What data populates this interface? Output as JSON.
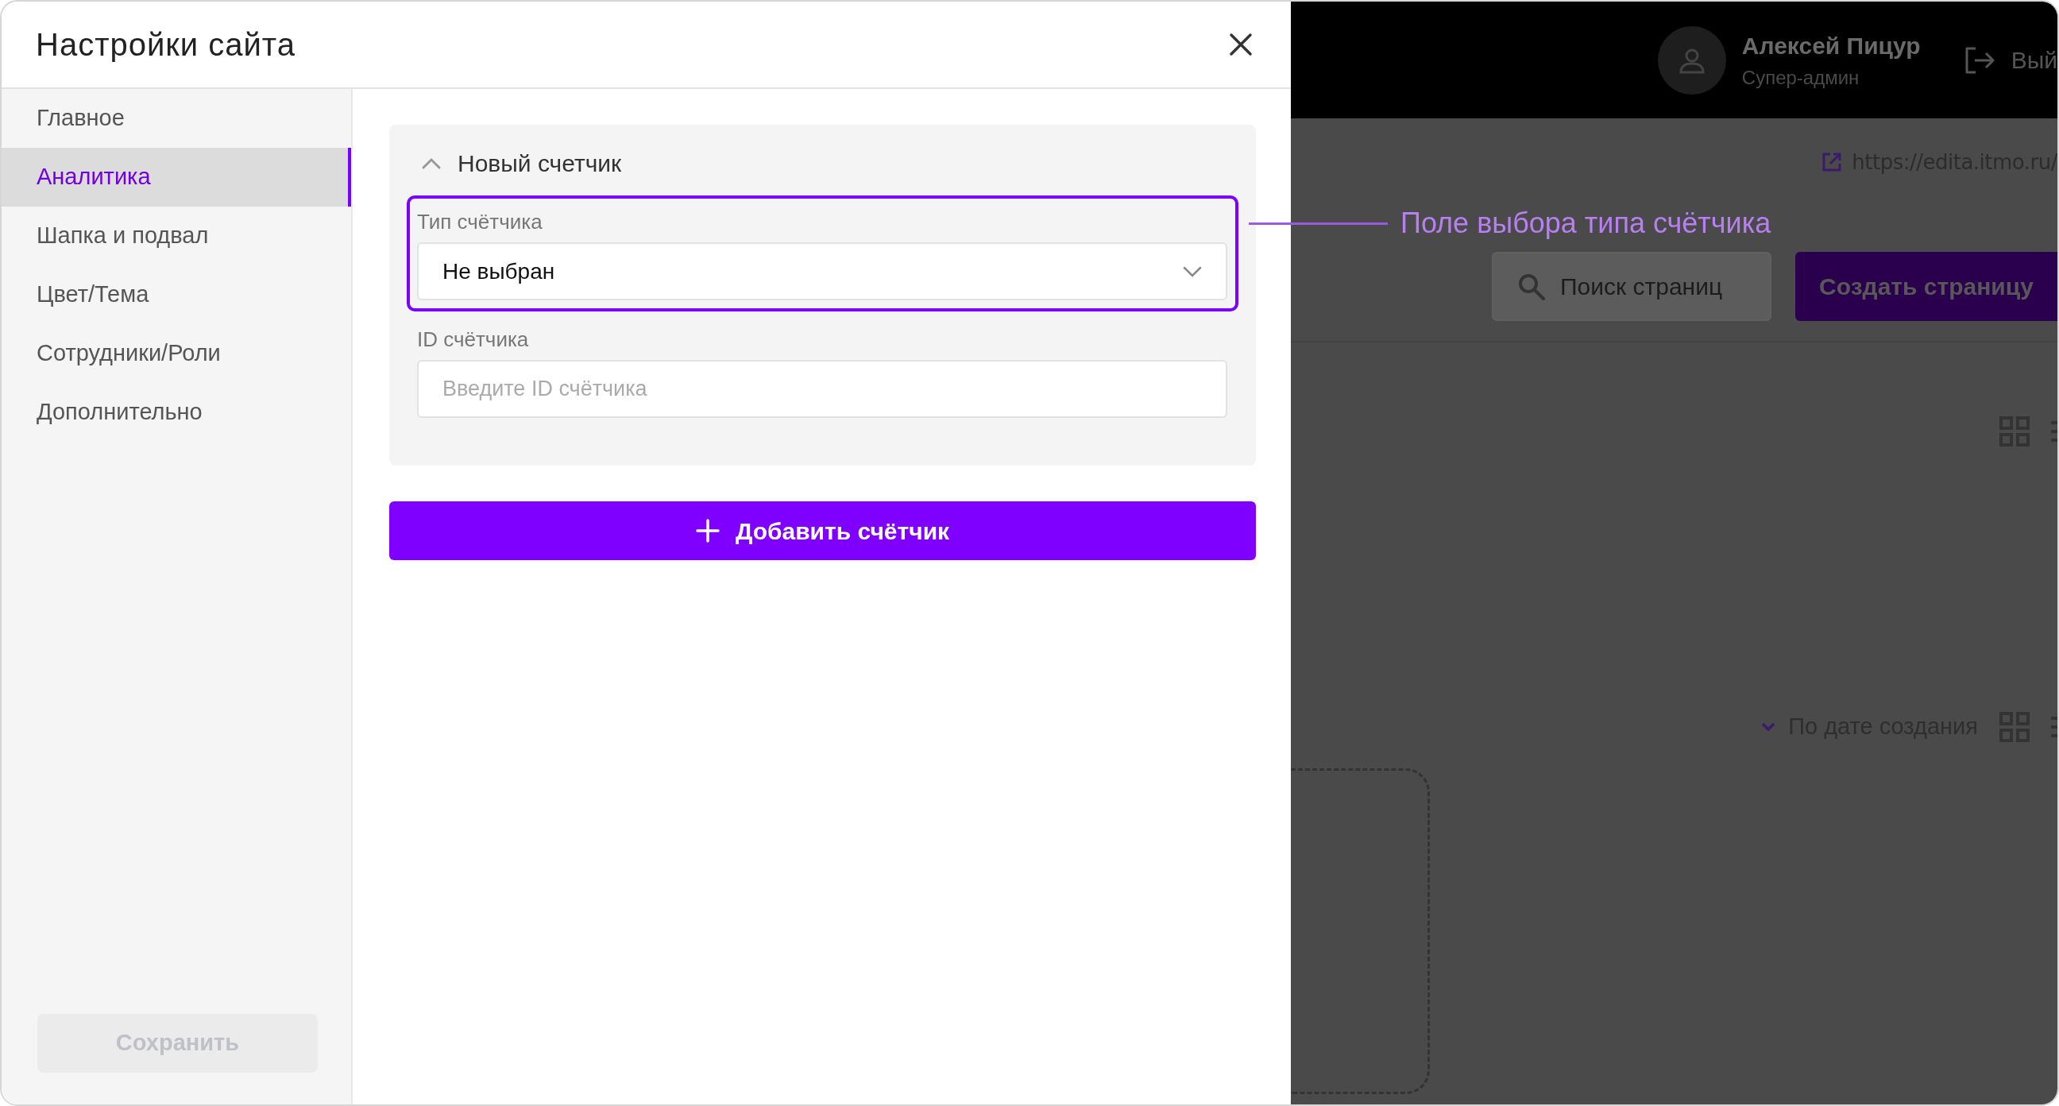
{
  "modal": {
    "title": "Настройки сайта",
    "sidebar": {
      "items": [
        {
          "label": "Главное",
          "selected": false
        },
        {
          "label": "Аналитика",
          "selected": true
        },
        {
          "label": "Шапка и подвал",
          "selected": false
        },
        {
          "label": "Цвет/Тема",
          "selected": false
        },
        {
          "label": "Сотрудники/Роли",
          "selected": false
        },
        {
          "label": "Дополнительно",
          "selected": false
        }
      ],
      "save_button": {
        "label": "Сохранить",
        "disabled": true
      }
    },
    "counter_section": {
      "title": "Новый счетчик",
      "expanded": true,
      "fields": [
        {
          "kind": "select",
          "label": "Тип счётчика",
          "value": "Не выбран",
          "highlighted": true
        },
        {
          "kind": "input",
          "label": "ID счётчика",
          "placeholder": "Введите ID счётчика",
          "highlighted": false
        }
      ]
    },
    "add_button": {
      "label": "Добавить счётчик"
    }
  },
  "annotation": {
    "text": "Поле выбора типа счётчика"
  },
  "background_page": {
    "user": {
      "name": "Алексей Пицур",
      "role": "Супер-админ"
    },
    "logout": "Вый",
    "site_link": "https://edita.itmo.ru/",
    "search": {
      "placeholder": "Поиск страниц"
    },
    "create_button": "Создать страницу",
    "sort": "По дате создания"
  }
}
